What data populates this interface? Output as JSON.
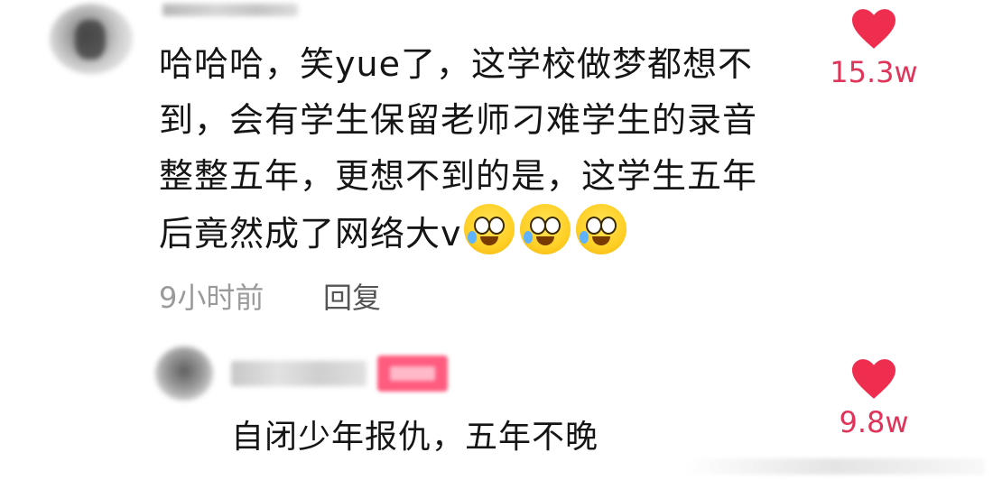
{
  "colors": {
    "accent": "#e0355a",
    "heart": "#ef2d4f",
    "text": "#151515",
    "meta": "#9a9a9a"
  },
  "comment": {
    "text": "哈哈哈，笑yue了，这学校做梦都想不\n到，会有学生保留老师刁难学生的录音\n整整五年，更想不到的是，这学生五年\n后竟然成了网络大v",
    "emojis": [
      "laugh-cry-emoji",
      "laugh-cry-emoji",
      "laugh-cry-emoji"
    ],
    "time": "9小时前",
    "reply_label": "回复",
    "likes": "15.3w"
  },
  "reply": {
    "text": "自闭少年报仇，五年不晚",
    "likes": "9.8w"
  }
}
